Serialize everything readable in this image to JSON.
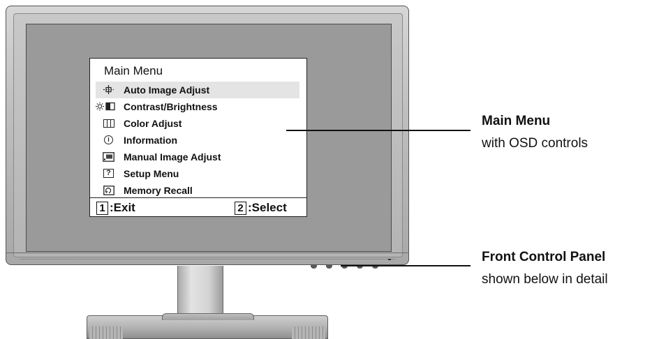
{
  "osd": {
    "title": "Main Menu",
    "items": [
      {
        "label": "Auto Image Adjust",
        "icon": "crosshair-icon",
        "selected": true
      },
      {
        "label": "Contrast/Brightness",
        "icon": "contrast-brightness-icon",
        "selected": false
      },
      {
        "label": "Color Adjust",
        "icon": "color-bars-icon",
        "selected": false
      },
      {
        "label": "Information",
        "icon": "info-icon",
        "selected": false
      },
      {
        "label": "Manual Image Adjust",
        "icon": "manual-adjust-icon",
        "selected": false
      },
      {
        "label": "Setup Menu",
        "icon": "question-icon",
        "selected": false
      },
      {
        "label": "Memory Recall",
        "icon": "memory-recall-icon",
        "selected": false
      }
    ],
    "footer": {
      "exit_key": "1",
      "exit_label": ":Exit",
      "select_key": "2",
      "select_label": ":Select"
    }
  },
  "callouts": {
    "main_menu": {
      "title": "Main Menu",
      "subtitle": "with OSD controls"
    },
    "front_panel": {
      "title": "Front Control Panel",
      "subtitle": "shown below in detail"
    }
  },
  "colors": {
    "bezel": "#c4c4c4",
    "screen": "#9a9a9a",
    "osd_background": "#ffffff",
    "selected_row": "#e4e4e4"
  }
}
